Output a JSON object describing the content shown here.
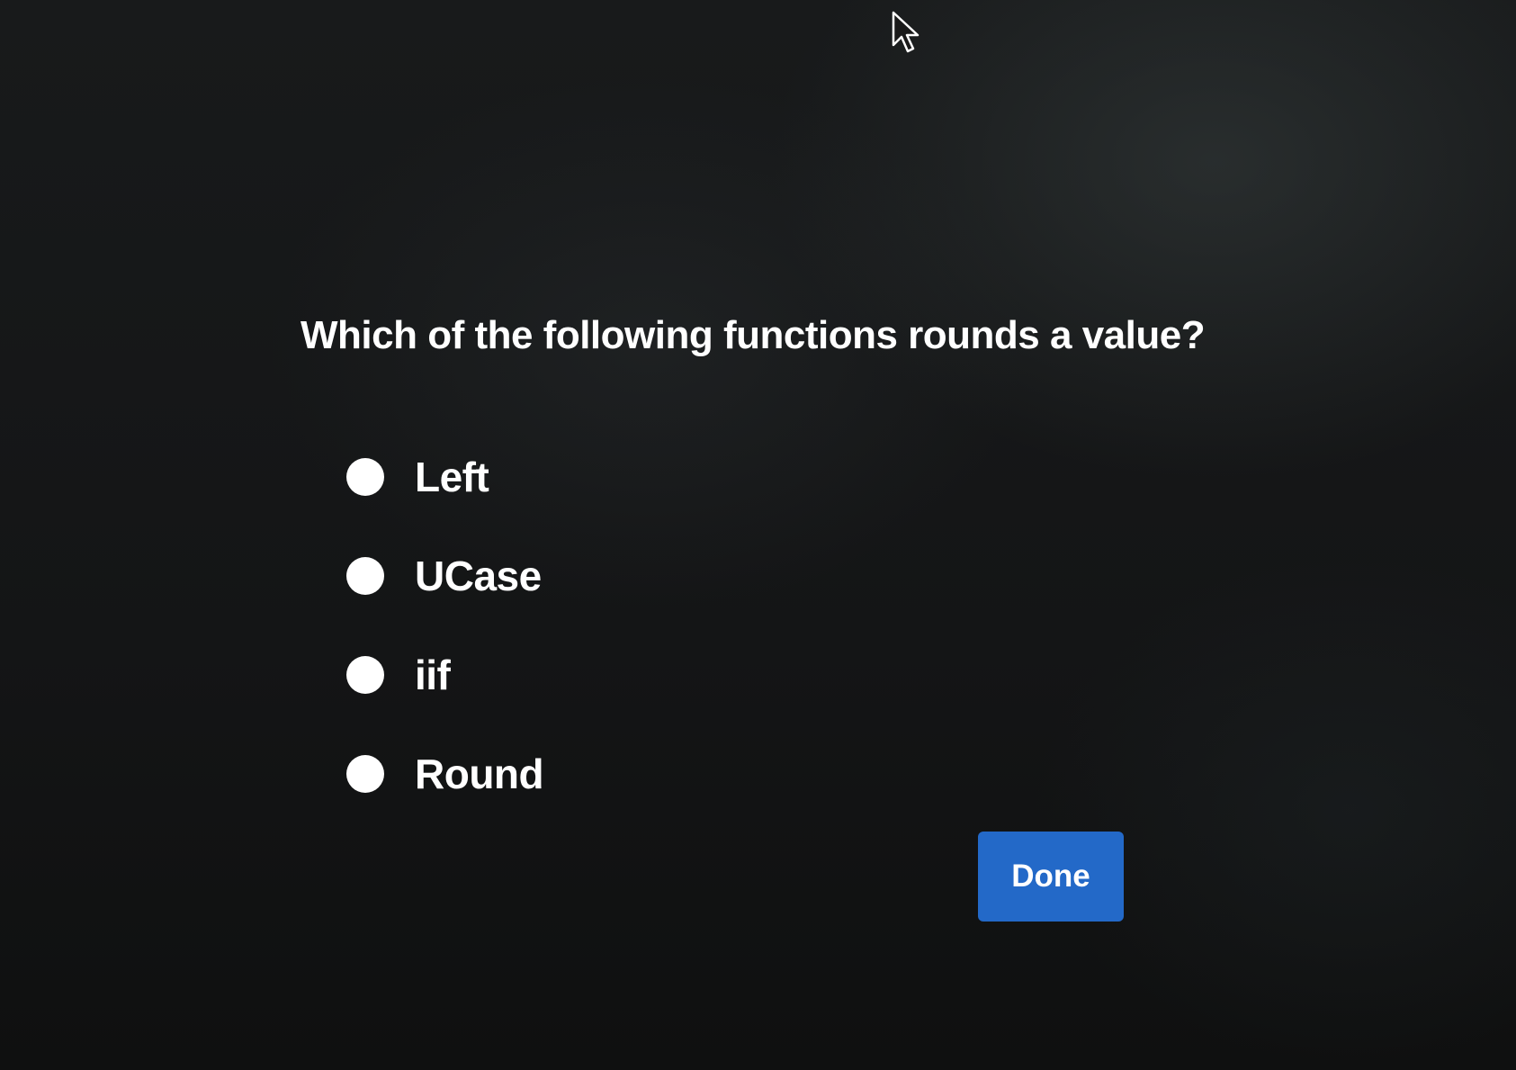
{
  "question": {
    "text": "Which of the following functions rounds a value?"
  },
  "options": [
    {
      "label": "Left",
      "selected": false
    },
    {
      "label": "UCase",
      "selected": false
    },
    {
      "label": "iif",
      "selected": false
    },
    {
      "label": "Round",
      "selected": false
    }
  ],
  "actions": {
    "done_label": "Done"
  },
  "colors": {
    "background": "#151617",
    "text": "#ffffff",
    "radio": "#ffffff",
    "done_button": "#2369c8"
  },
  "icons": {
    "cursor": "mouse-pointer-icon"
  }
}
